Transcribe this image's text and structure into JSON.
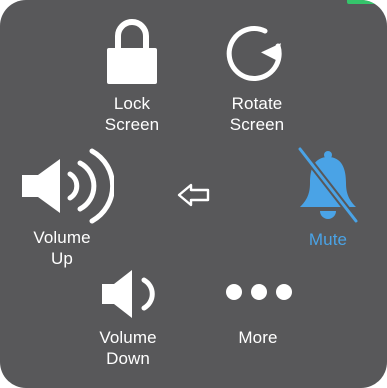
{
  "menu": {
    "items": [
      {
        "id": "lock-screen",
        "label_line1": "Lock",
        "label_line2": "Screen",
        "icon": "lock-icon"
      },
      {
        "id": "rotate-screen",
        "label_line1": "Rotate",
        "label_line2": "Screen",
        "icon": "rotate-icon"
      },
      {
        "id": "volume-up",
        "label_line1": "Volume",
        "label_line2": "Up",
        "icon": "speaker-loud-icon"
      },
      {
        "id": "mute",
        "label_line1": "Mute",
        "icon": "bell-slash-icon"
      },
      {
        "id": "volume-down",
        "label_line1": "Volume",
        "label_line2": "Down",
        "icon": "speaker-soft-icon"
      },
      {
        "id": "more",
        "label_line1": "More",
        "icon": "ellipsis-icon"
      }
    ],
    "back_icon": "back-arrow-icon"
  },
  "colors": {
    "panel_background": "#58585a",
    "text": "#ffffff",
    "mute_accent": "#4aa3e6",
    "status_strip": "#35c46b"
  }
}
